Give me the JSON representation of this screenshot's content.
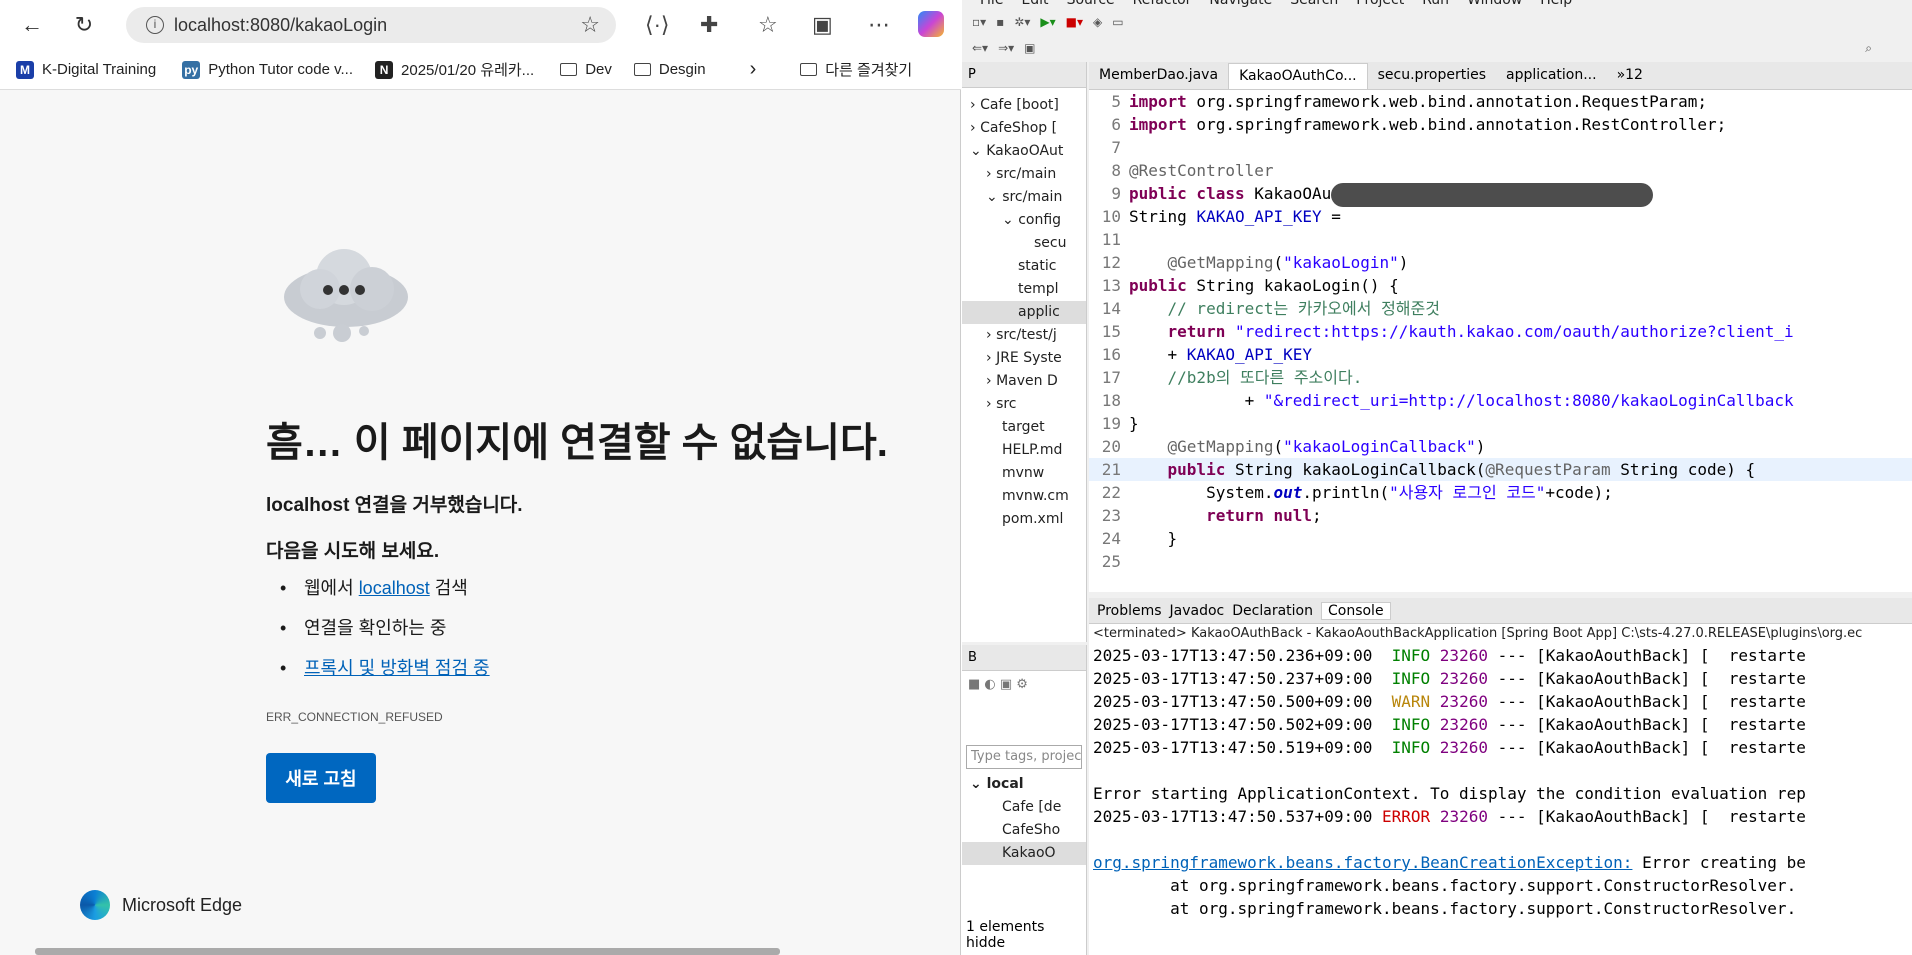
{
  "browser": {
    "url": "localhost:8080/kakaoLogin",
    "bookmarks": [
      {
        "label": "K-Digital Training",
        "icon": "M",
        "color": "#1a3ea8"
      },
      {
        "label": "Python Tutor code v...",
        "icon": "py",
        "color": "#3570a4"
      },
      {
        "label": "2025/01/20 유레카...",
        "icon": "N",
        "color": "#222"
      },
      {
        "label": "Dev",
        "icon": "folder"
      },
      {
        "label": "Desgin",
        "icon": "folder"
      }
    ],
    "other_bookmarks": "다른 즐겨찾기"
  },
  "error_page": {
    "title": "흠… 이 페이지에 연결할 수 없습니다.",
    "subtitle": "localhost 연결을 거부했습니다.",
    "try_heading": "다음을 시도해 보세요.",
    "suggestion1_pre": "웹에서 ",
    "suggestion1_link": "localhost",
    "suggestion1_post": " 검색",
    "suggestion2": "연결을 확인하는 중",
    "suggestion3": "프록시 및 방화벽 점검 중",
    "code": "ERR_CONNECTION_REFUSED",
    "reload": "새로 고침",
    "brand": "Microsoft Edge"
  },
  "ide": {
    "menu": [
      "File",
      "Edit",
      "Source",
      "Refactor",
      "Navigate",
      "Search",
      "Project",
      "Run",
      "Window",
      "Help"
    ],
    "pkg_tab": "P",
    "tree": [
      "Cafe [boot]",
      "CafeShop [",
      "KakaoOAut",
      "src/main",
      "src/main",
      "config",
      "secu",
      "static",
      "templ",
      "applic",
      "src/test/j",
      "JRE Syste",
      "Maven D",
      "src",
      "target",
      "HELP.md",
      "mvnw",
      "mvnw.cm",
      "pom.xml"
    ],
    "sv_tab": "B",
    "filter_placeholder": "Type tags, projec",
    "sv_tree": [
      "local",
      "Cafe [de",
      "CafeSho",
      "KakaoO"
    ],
    "hidden": "1 elements hidde",
    "editor_tabs": [
      "MemberDao.java",
      "KakaoOAuthCo...",
      "secu.properties",
      "application...",
      "»12"
    ],
    "console_tabs": [
      "Problems",
      "Javadoc",
      "Declaration",
      "Console"
    ],
    "console_header": "<terminated> KakaoOAuthBack - KakaoAouthBackApplication [Spring Boot App] C:\\sts-4.27.0.RELEASE\\plugins\\org.ec",
    "logs": [
      {
        "ts": "2025-03-17T13:47:50.236+09:00",
        "lvl": "INFO",
        "pid": "23260",
        "rest": " --- [KakaoAouthBack] [  restarte"
      },
      {
        "ts": "2025-03-17T13:47:50.237+09:00",
        "lvl": "INFO",
        "pid": "23260",
        "rest": " --- [KakaoAouthBack] [  restarte"
      },
      {
        "ts": "2025-03-17T13:47:50.500+09:00",
        "lvl": "WARN",
        "pid": "23260",
        "rest": " --- [KakaoAouthBack] [  restarte"
      },
      {
        "ts": "2025-03-17T13:47:50.502+09:00",
        "lvl": "INFO",
        "pid": "23260",
        "rest": " --- [KakaoAouthBack] [  restarte"
      },
      {
        "ts": "2025-03-17T13:47:50.519+09:00",
        "lvl": "INFO",
        "pid": "23260",
        "rest": " --- [KakaoAouthBack] [  restarte"
      }
    ],
    "err_line1": "Error starting ApplicationContext. To display the condition evaluation rep",
    "err_ts": "2025-03-17T13:47:50.537+09:00",
    "err_lvl": "ERROR",
    "err_pid": "23260",
    "err_rest": " --- [KakaoAouthBack] [  restarte",
    "exc": "org.springframework.beans.factory.BeanCreationException:",
    "exc_rest": " Error creating be",
    "at1": "        at org.springframework.beans.factory.support.ConstructorResolver.",
    "at2": "        at org.springframework.beans.factory.support.ConstructorResolver."
  }
}
